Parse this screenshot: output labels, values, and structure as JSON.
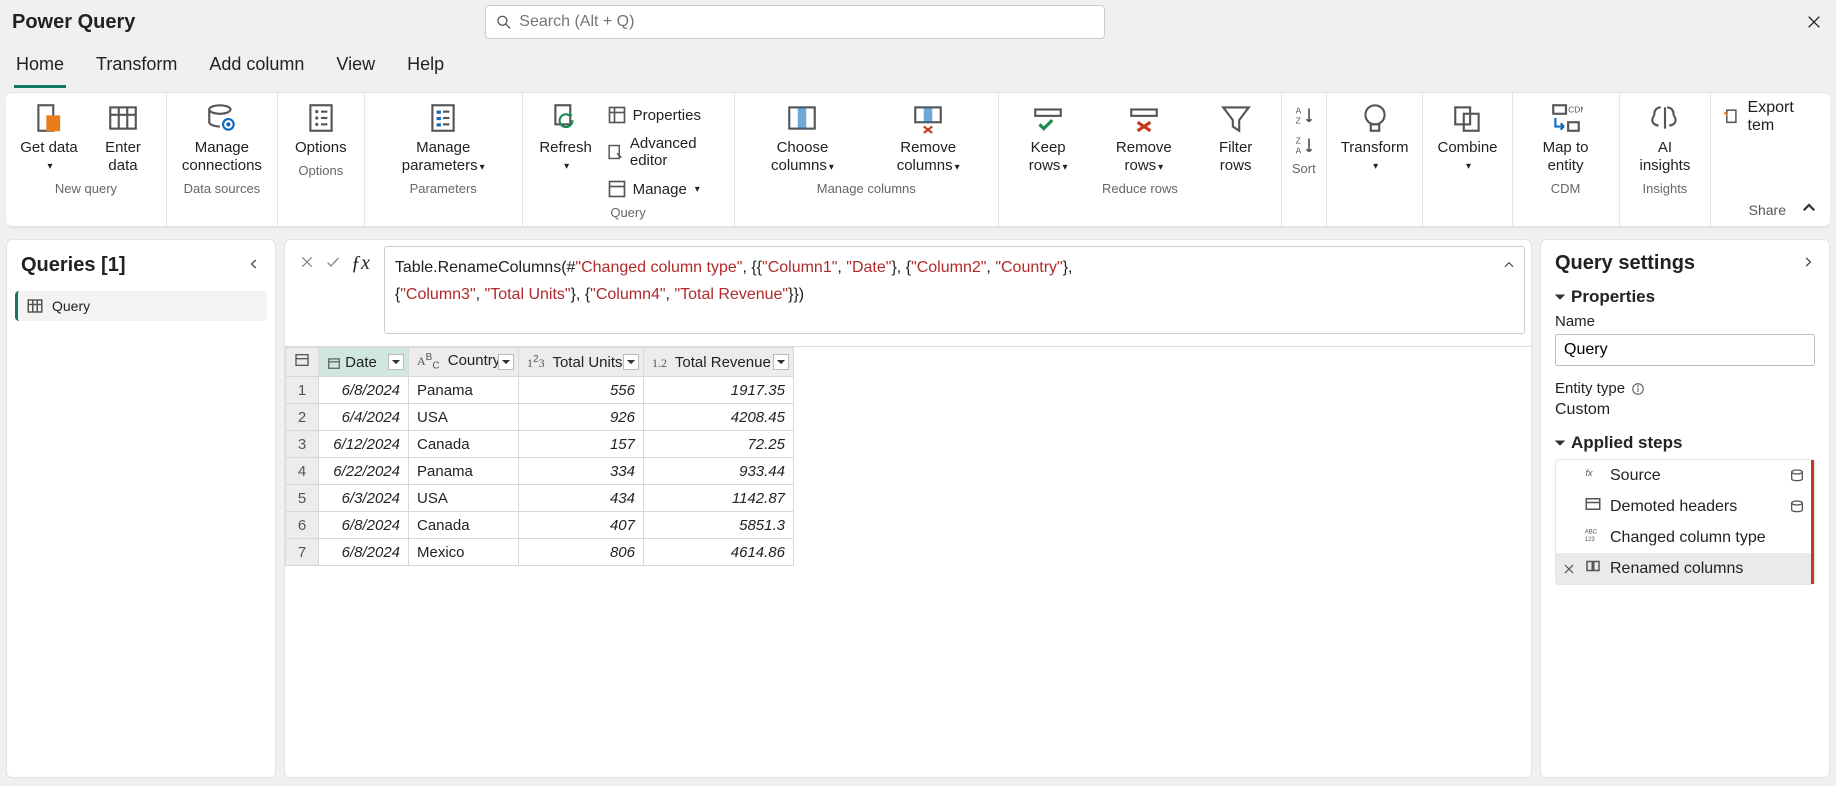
{
  "app": {
    "title": "Power Query"
  },
  "search": {
    "placeholder": "Search (Alt + Q)"
  },
  "tabs": [
    "Home",
    "Transform",
    "Add column",
    "View",
    "Help"
  ],
  "active_tab": 0,
  "ribbon": {
    "get_data": "Get data",
    "enter_data": "Enter data",
    "group_new_query": "New query",
    "manage_connections": "Manage connections",
    "group_data_sources": "Data sources",
    "options": "Options",
    "group_options": "Options",
    "manage_parameters": "Manage parameters",
    "group_parameters": "Parameters",
    "refresh": "Refresh",
    "properties": "Properties",
    "advanced_editor": "Advanced editor",
    "manage": "Manage",
    "group_query": "Query",
    "choose_columns": "Choose columns",
    "remove_columns": "Remove columns",
    "group_manage_columns": "Manage columns",
    "keep_rows": "Keep rows",
    "remove_rows": "Remove rows",
    "filter_rows": "Filter rows",
    "group_reduce_rows": "Reduce rows",
    "group_sort": "Sort",
    "transform": "Transform",
    "combine": "Combine",
    "map_to_entity": "Map to entity",
    "group_cdm": "CDM",
    "ai_insights": "AI insights",
    "group_insights": "Insights",
    "export_template": "Export tem",
    "share": "Share"
  },
  "queries": {
    "title": "Queries [1]",
    "items": [
      "Query"
    ]
  },
  "formula": {
    "pre1": "Table.RenameColumns(#",
    "s1": "\"Changed column type\"",
    "mid1": ", {{",
    "s2": "\"Column1\"",
    "mid2": ", ",
    "s3": "\"Date\"",
    "mid3": "}, {",
    "s4": "\"Column2\"",
    "mid4": ", ",
    "s5": "\"Country\"",
    "mid5": "},",
    "line2a": "{",
    "s6": "\"Column3\"",
    "mid6": ", ",
    "s7": "\"Total Units\"",
    "mid7": "}, {",
    "s8": "\"Column4\"",
    "mid8": ", ",
    "s9": "\"Total Revenue\"",
    "post": "}})"
  },
  "columns": {
    "c0": "Date",
    "c1": "Country",
    "c2": "Total Units",
    "c3": "Total Revenue"
  },
  "col_types": {
    "c0": "",
    "c1": "ABC",
    "c2": "123",
    "c3": "1.2"
  },
  "rows": [
    {
      "n": "1",
      "date": "6/8/2024",
      "country": "Panama",
      "units": "556",
      "rev": "1917.35"
    },
    {
      "n": "2",
      "date": "6/4/2024",
      "country": "USA",
      "units": "926",
      "rev": "4208.45"
    },
    {
      "n": "3",
      "date": "6/12/2024",
      "country": "Canada",
      "units": "157",
      "rev": "72.25"
    },
    {
      "n": "4",
      "date": "6/22/2024",
      "country": "Panama",
      "units": "334",
      "rev": "933.44"
    },
    {
      "n": "5",
      "date": "6/3/2024",
      "country": "USA",
      "units": "434",
      "rev": "1142.87"
    },
    {
      "n": "6",
      "date": "6/8/2024",
      "country": "Canada",
      "units": "407",
      "rev": "5851.3"
    },
    {
      "n": "7",
      "date": "6/8/2024",
      "country": "Mexico",
      "units": "806",
      "rev": "4614.86"
    }
  ],
  "settings": {
    "title": "Query settings",
    "properties": "Properties",
    "name_label": "Name",
    "name_value": "Query",
    "entity_type_label": "Entity type",
    "entity_type_value": "Custom",
    "applied_steps": "Applied steps",
    "steps": [
      "Source",
      "Demoted headers",
      "Changed column type",
      "Renamed columns"
    ],
    "current_step": 3
  }
}
